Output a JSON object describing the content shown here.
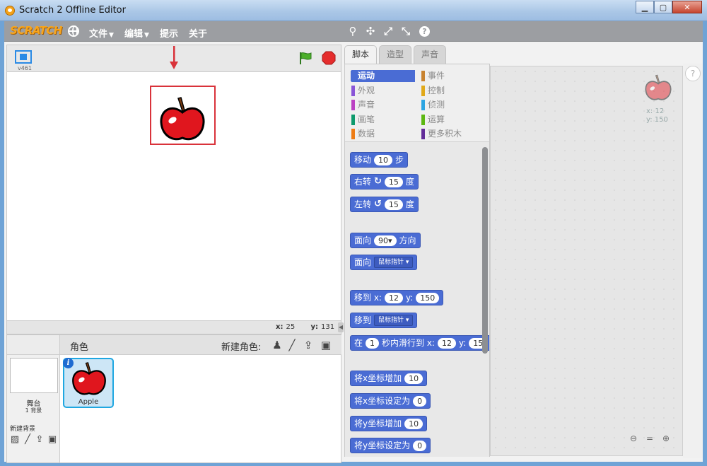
{
  "window": {
    "title": "Scratch 2 Offline Editor",
    "min_label": "▁",
    "max_label": "▢",
    "close_label": "✕"
  },
  "menubar": {
    "logo": "SCRATCH",
    "menus": [
      {
        "label": "文件",
        "has_caret": true
      },
      {
        "label": "编辑",
        "has_caret": true
      },
      {
        "label": "提示",
        "has_caret": false
      },
      {
        "label": "关于",
        "has_caret": false
      }
    ],
    "tools": [
      "duplicate-icon",
      "delete-icon",
      "grow-icon",
      "shrink-icon",
      "help-icon"
    ],
    "tool_glyphs": [
      "⚲",
      "✣",
      "⤢",
      "⤡",
      "?"
    ]
  },
  "stage": {
    "version": "v461",
    "mouse_x_label": "x:",
    "mouse_x": "25",
    "mouse_y_label": "y:",
    "mouse_y": "131"
  },
  "tabs": [
    {
      "label": "脚本",
      "active": true
    },
    {
      "label": "造型",
      "active": false
    },
    {
      "label": "声音",
      "active": false
    }
  ],
  "categories": [
    {
      "label": "运动",
      "color": "#4a6cd4",
      "active": true
    },
    {
      "label": "外观",
      "color": "#8a55d7",
      "active": false
    },
    {
      "label": "声音",
      "color": "#bb42c3",
      "active": false
    },
    {
      "label": "画笔",
      "color": "#0e9a6c",
      "active": false
    },
    {
      "label": "数据",
      "color": "#ee7d16",
      "active": false
    },
    {
      "label": "事件",
      "color": "#c88330",
      "active": false
    },
    {
      "label": "控制",
      "color": "#e1a91a",
      "active": false
    },
    {
      "label": "侦测",
      "color": "#2ca5e2",
      "active": false
    },
    {
      "label": "运算",
      "color": "#5cb712",
      "active": false
    },
    {
      "label": "更多积木",
      "color": "#632d99",
      "active": false
    }
  ],
  "blocks": {
    "move": {
      "a": "移动",
      "n": "10",
      "b": "步"
    },
    "turn_right": {
      "a": "右转",
      "n": "15",
      "b": "度"
    },
    "turn_left": {
      "a": "左转",
      "n": "15",
      "b": "度"
    },
    "point_dir": {
      "a": "面向",
      "n": "90▾",
      "b": "方向"
    },
    "point_towards": {
      "a": "面向",
      "d": "鼠标指针"
    },
    "goto_xy": {
      "a": "移到 x:",
      "x": "12",
      "yl": "y:",
      "y": "150"
    },
    "goto": {
      "a": "移到",
      "d": "鼠标指针"
    },
    "glide": {
      "a": "在",
      "n": "1",
      "b": "秒内滑行到 x:",
      "x": "12",
      "yl": "y:",
      "y": "15"
    },
    "change_x": {
      "a": "将x坐标增加",
      "n": "10"
    },
    "set_x": {
      "a": "将x坐标设定为",
      "n": "0"
    },
    "change_y": {
      "a": "将y坐标增加",
      "n": "10"
    },
    "set_y": {
      "a": "将y坐标设定为",
      "n": "0"
    }
  },
  "scripts_area": {
    "sprite_x": "x: 12",
    "sprite_y": "y: 150"
  },
  "sprite_pane": {
    "sprites_label": "角色",
    "new_sprite_label": "新建角色:",
    "stage_name": "舞台",
    "backdrop_count": "1 背景",
    "new_backdrop_label": "新建背景",
    "sprite_name": "Apple"
  }
}
